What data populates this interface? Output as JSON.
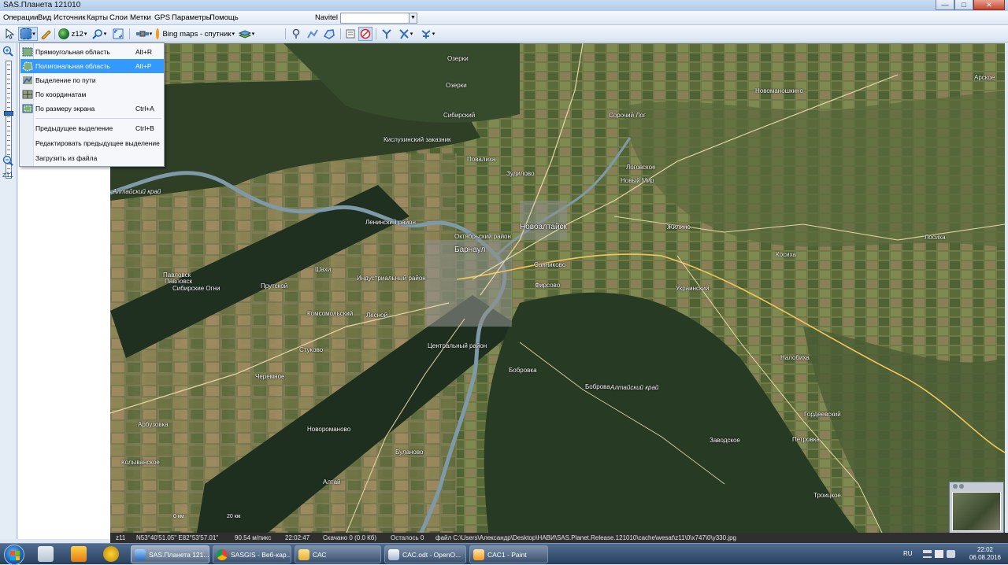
{
  "window": {
    "title": "SAS.Планета 121010",
    "minimize": "—",
    "maximize": "□",
    "close": "✕"
  },
  "menu": {
    "items": [
      "Операции",
      "Вид",
      "Источник",
      "Карты",
      "Слои",
      "Метки",
      "GPS",
      "Параметры",
      "Помощь"
    ],
    "navitel_label": "Navitel",
    "navitel_value": ""
  },
  "toolbar": {
    "zoom_label": "z12",
    "map_source_label": "Bing maps - спутник"
  },
  "zoom_panel": {
    "level_label": "z11",
    "level_fraction": 0.45
  },
  "selection_menu": {
    "items": [
      {
        "label": "Прямоугольная область",
        "shortcut": "Alt+R",
        "icon": "rectangle-area-icon"
      },
      {
        "label": "Полигональная область",
        "shortcut": "Alt+P",
        "icon": "polygon-area-icon",
        "highlighted": true
      },
      {
        "label": "Выделение по пути",
        "shortcut": "",
        "icon": "path-selection-icon"
      },
      {
        "label": "По координатам",
        "shortcut": "",
        "icon": "coordinates-icon"
      },
      {
        "label": "По размеру экрана",
        "shortcut": "Ctrl+A",
        "icon": "screen-size-icon"
      },
      {
        "label": "Предыдущее выделение",
        "shortcut": "Ctrl+B",
        "icon": ""
      },
      {
        "label": "Редактировать предыдущее выделение",
        "shortcut": "",
        "icon": ""
      },
      {
        "label": "Загрузить из файла",
        "shortcut": "",
        "icon": ""
      }
    ]
  },
  "map": {
    "places": [
      {
        "name": "Озерки",
        "type": "town"
      },
      {
        "name": "Озерки",
        "type": "town"
      },
      {
        "name": "Сибирский",
        "type": "town"
      },
      {
        "name": "Сорочий Лог",
        "type": "town"
      },
      {
        "name": "Новоманошкино",
        "type": "town"
      },
      {
        "name": "Арское",
        "type": "town"
      },
      {
        "name": "Кислухинский заказник",
        "type": "area"
      },
      {
        "name": "Повалиха",
        "type": "town"
      },
      {
        "name": "Зудилово",
        "type": "town"
      },
      {
        "name": "Логовское",
        "type": "town"
      },
      {
        "name": "Новый Мир",
        "type": "town"
      },
      {
        "name": "Ленинский район",
        "type": "district"
      },
      {
        "name": "Новоалтайск",
        "type": "city"
      },
      {
        "name": "Октябрьский район",
        "type": "district"
      },
      {
        "name": "Барнаул",
        "type": "city"
      },
      {
        "name": "Жилино",
        "type": "town"
      },
      {
        "name": "Лосиха",
        "type": "town"
      },
      {
        "name": "Косиха",
        "type": "town"
      },
      {
        "name": "Санниково",
        "type": "town"
      },
      {
        "name": "Шахи",
        "type": "town"
      },
      {
        "name": "Индустриальный район",
        "type": "district"
      },
      {
        "name": "Фирсово",
        "type": "town"
      },
      {
        "name": "Украинский",
        "type": "town"
      },
      {
        "name": "Павловск",
        "type": "town"
      },
      {
        "name": "Павловск",
        "type": "town"
      },
      {
        "name": "Сибирские Огни",
        "type": "town"
      },
      {
        "name": "Прутской",
        "type": "town"
      },
      {
        "name": "Комсомольский",
        "type": "town"
      },
      {
        "name": "Лесной",
        "type": "town"
      },
      {
        "name": "Центральный район",
        "type": "district"
      },
      {
        "name": "Налобиха",
        "type": "town"
      },
      {
        "name": "Стуково",
        "type": "town"
      },
      {
        "name": "Черемное",
        "type": "town"
      },
      {
        "name": "Боброва",
        "type": "town"
      },
      {
        "name": "Бобровка",
        "type": "town"
      },
      {
        "name": "Гордеевский",
        "type": "town"
      },
      {
        "name": "Арбузовка",
        "type": "town"
      },
      {
        "name": "Новороманово",
        "type": "town"
      },
      {
        "name": "Заводское",
        "type": "town"
      },
      {
        "name": "Петровка",
        "type": "town"
      },
      {
        "name": "Буланово",
        "type": "town"
      },
      {
        "name": "Колыванское",
        "type": "town"
      },
      {
        "name": "Алтай",
        "type": "town"
      },
      {
        "name": "Троицкое",
        "type": "town"
      }
    ],
    "regions": [
      "Алтайский край",
      "Алтайский край"
    ],
    "scale": {
      "a": "0 км",
      "b": "20 км"
    }
  },
  "status": {
    "zoom": "z11",
    "coords": "N53°40'51.05\" E82°53'57.01\"",
    "resolution": "90.54 м/пикс",
    "time": "22:02:47",
    "downloaded": "Скачано 0 (0.0 Кб)",
    "remaining": "Осталось 0",
    "file": "файл C:\\Users\\Александр\\Desktop\\НАВИ\\SAS.Planet.Release.121010\\cache\\wesat\\z11\\0\\x747\\0\\y330.jpg"
  },
  "taskbar": {
    "tasks": [
      {
        "label": "SAS.Планета 121...",
        "icon": "sas-planet-icon",
        "active": true
      },
      {
        "label": "SASGIS - Веб-кар...",
        "icon": "chrome-icon",
        "active": false
      },
      {
        "label": "САС",
        "icon": "folder-icon",
        "active": false
      },
      {
        "label": "CAC.odt - OpenO...",
        "icon": "openoffice-icon",
        "active": false
      },
      {
        "label": "CAC1 - Paint",
        "icon": "paint-icon",
        "active": false
      }
    ],
    "lang": "RU",
    "time": "22:02",
    "date": "06.08.2016"
  },
  "colors": {
    "menu_highlight": "#3399ff",
    "taskbar": "#29405d",
    "road": "#f2c75a"
  }
}
